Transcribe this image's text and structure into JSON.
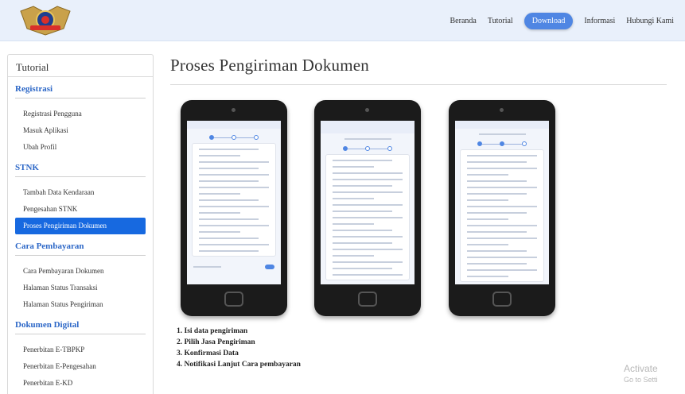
{
  "nav": {
    "items": [
      "Beranda",
      "Tutorial",
      "Download",
      "Informasi",
      "Hubungi Kami"
    ],
    "active_index": 2
  },
  "sidebar": {
    "title": "Tutorial",
    "sections": [
      {
        "title": "Registrasi",
        "items": [
          "Registrasi Pengguna",
          "Masuk Aplikasi",
          "Ubah Profil"
        ]
      },
      {
        "title": "STNK",
        "items": [
          "Tambah Data Kendaraan",
          "Pengesahan STNK",
          "Proses Pengiriman Dokumen"
        ]
      },
      {
        "title": "Cara Pembayaran",
        "items": [
          "Cara Pembayaran Dokumen",
          "Halaman Status Transaksi",
          "Halaman Status Pengiriman"
        ]
      },
      {
        "title": "Dokumen Digital",
        "items": [
          "Penerbitan E-TBPKP",
          "Penerbitan E-Pengesahan",
          "Penerbitan E-KD"
        ]
      }
    ],
    "active_item": "Proses Pengiriman Dokumen"
  },
  "main": {
    "title": "Proses Pengiriman Dokumen",
    "steps": [
      "1. Isi data pengiriman",
      "2. Pilih Jasa Pengiriman",
      "3. Konfirmasi Data",
      "4. Notifikasi Lanjut Cara pembayaran"
    ]
  },
  "watermark": {
    "line1": "Activate",
    "line2": "Go to Setti"
  },
  "colors": {
    "accent": "#1769e0",
    "nav_active": "#4f86e3",
    "section_title": "#2c67c7",
    "topbar": "#e9f0fb"
  },
  "icons": {
    "logo": "samsat-logo",
    "phones": "phone-screenshot"
  }
}
